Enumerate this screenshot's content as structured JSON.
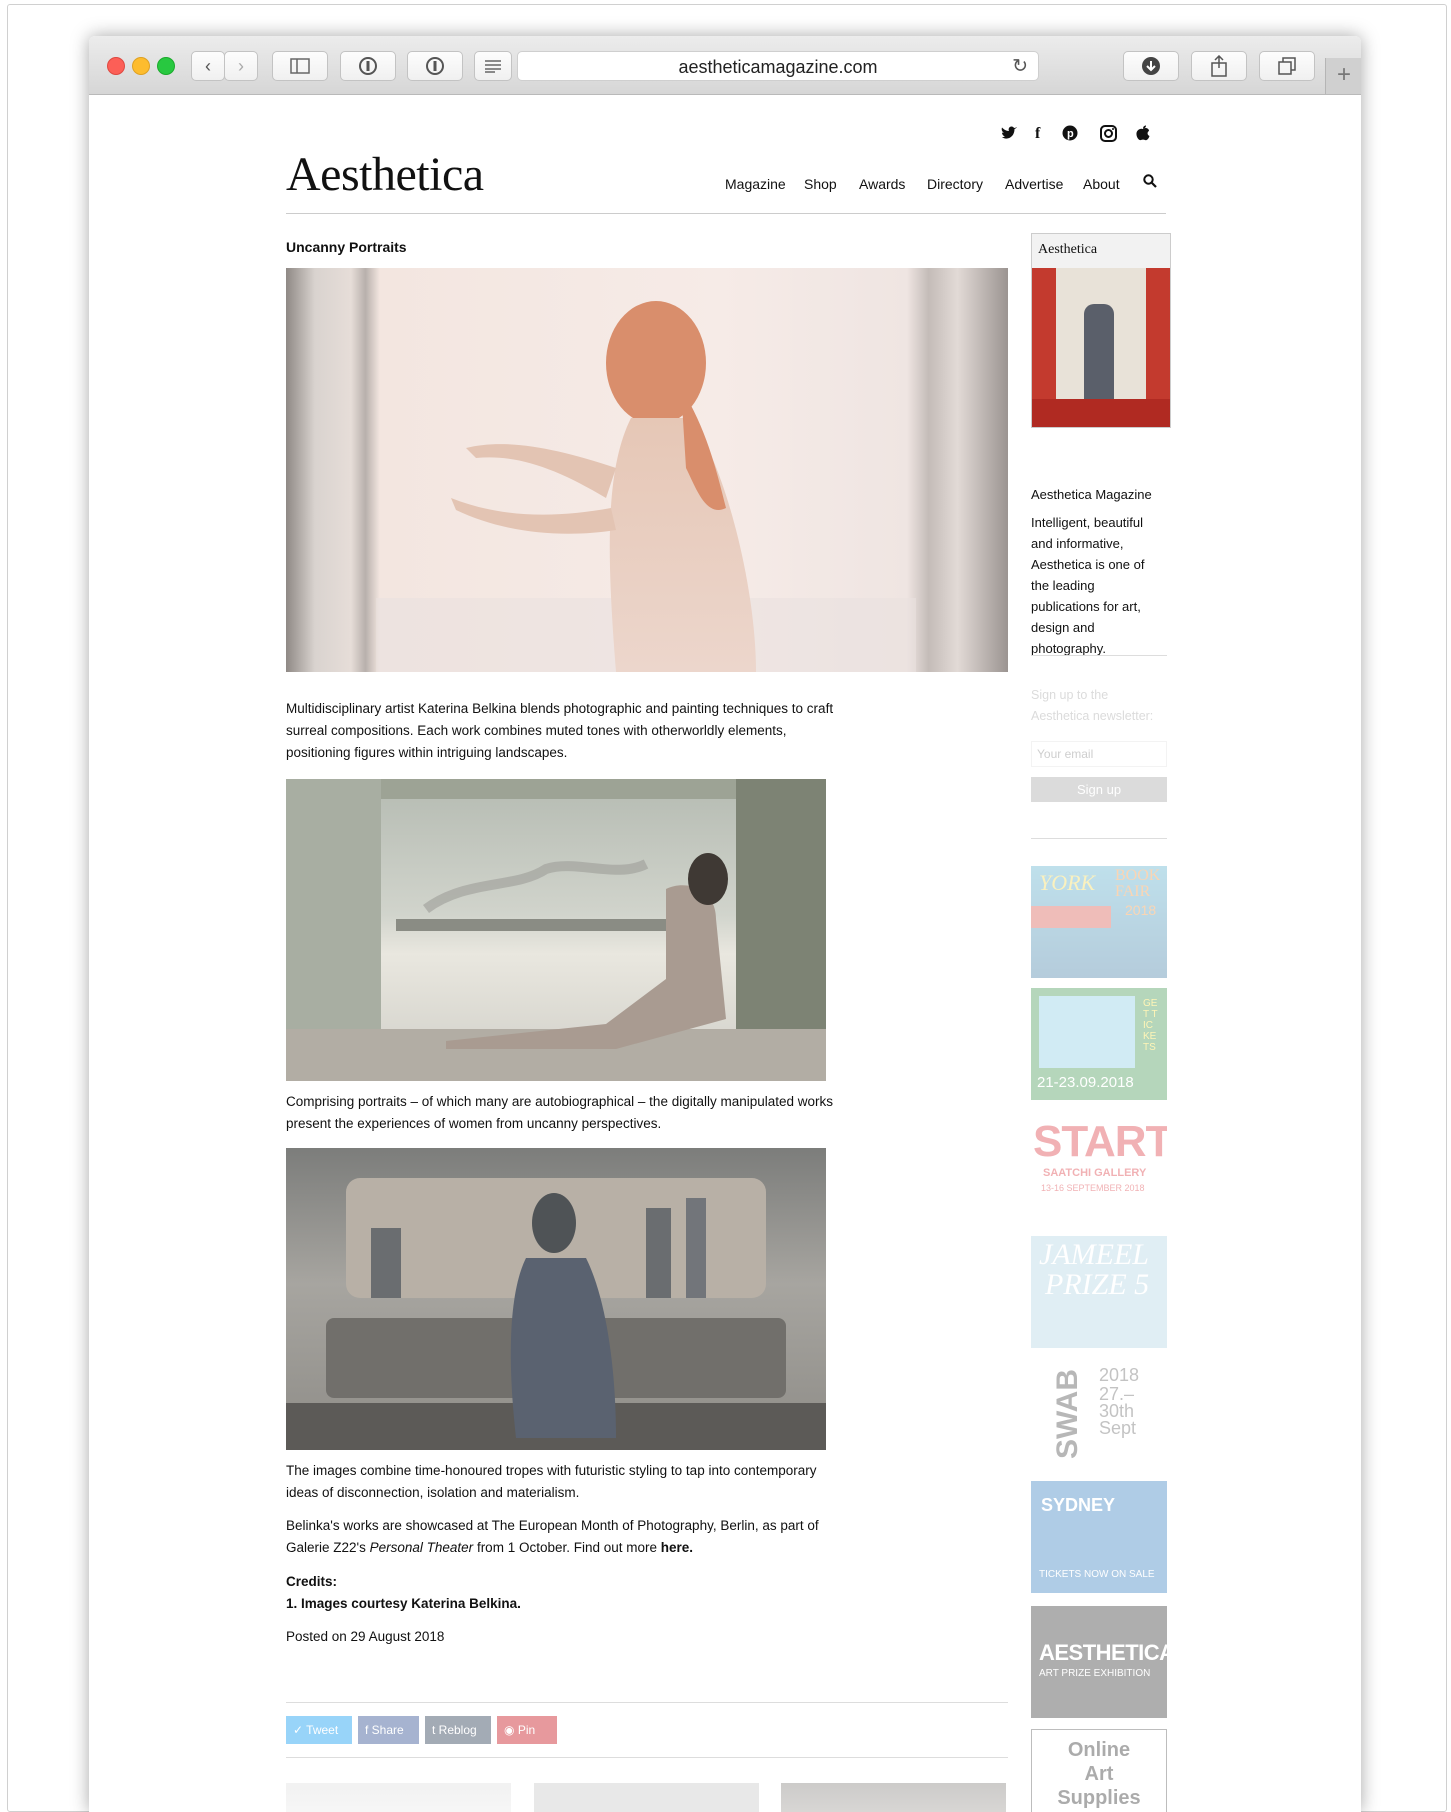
{
  "browser": {
    "url": "aestheticamagazine.com",
    "new_tab": "+"
  },
  "site": {
    "logo": "Aesthetica",
    "social": [
      "twitter-icon",
      "facebook-icon",
      "pinterest-icon",
      "instagram-icon",
      "apple-icon"
    ],
    "nav": [
      "Magazine",
      "Shop",
      "Awards",
      "Directory",
      "Advertise",
      "About"
    ]
  },
  "article": {
    "kicker": "Uncanny Portraits",
    "p1": "Multidisciplinary artist Katerina Belkina blends photographic and painting techniques to craft surreal compositions. Each work combines muted tones with otherworldly elements, positioning figures within intriguing landscapes.",
    "p2": "Comprising portraits – of which many are autobiographical – the digitally manipulated works present the experiences of women from uncanny perspectives.",
    "p3": "The images combine time-honoured tropes with futuristic styling to tap into contemporary ideas of disconnection, isolation and materialism.",
    "p4_a": "Belinka's works are showcased at The European Month of Photography, Berlin, as part of Galerie Z22's ",
    "p4_em": "Personal Theater",
    "p4_b": " from 1 October. Find out more ",
    "p4_link": "here.",
    "credits_label": "Credits:",
    "credits_item": "1. Images courtesy Katerina Belkina.",
    "posted": "Posted on 29 August 2018",
    "share": [
      "Tweet",
      "Share",
      "Reblog",
      "Pin"
    ]
  },
  "sidebar": {
    "cover_title": "Aesthetica",
    "mag_title": "Aesthetica Magazine",
    "mag_desc": "Intelligent, beautiful and informative, Aesthetica is one of the leading publications for art, design and photography.",
    "newsletter_prompt": "Sign up to the Aesthetica newsletter:",
    "email_placeholder": "Your email",
    "signup_label": "Sign up",
    "ad_book_fair_1": "YORK",
    "ad_book_fair_2": "BOOK FAIR",
    "ad_book_fair_3": "2018",
    "ad_unseen_dates": "21-23.09.2018",
    "ad_unseen_side": "GET TICKETS",
    "ad_start_1": "START",
    "ad_start_2": "SAATCHI GALLERY",
    "ad_start_3": "13-16 SEPTEMBER 2018",
    "ad_jameel_1": "JAMEEL",
    "ad_jameel_2": "PRIZE 5",
    "ad_swab_1": "SWAB",
    "ad_swab_2": "2018",
    "ad_swab_3": "27.–",
    "ad_swab_4": "30th",
    "ad_swab_5": "Sept",
    "ad_sydney_1": "SYDNEY",
    "ad_sydney_2": "TICKETS NOW ON SALE",
    "ad_aesthetica_1": "AESTHETICA",
    "ad_aesthetica_2": "ART PRIZE EXHIBITION",
    "ad_online": "Online Art Supplies"
  }
}
